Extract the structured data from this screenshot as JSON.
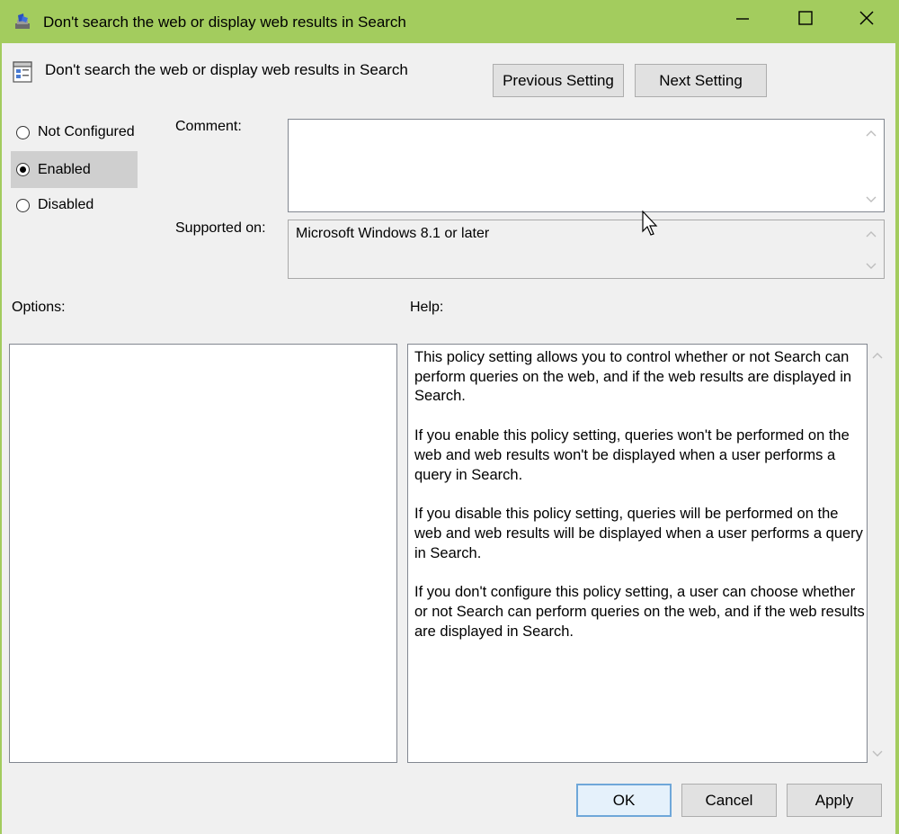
{
  "window": {
    "title": "Don't search the web or display web results in Search"
  },
  "header": {
    "setting_name": "Don't search the web or display web results in Search",
    "previous_label": "Previous Setting",
    "next_label": "Next Setting"
  },
  "state": {
    "options": [
      {
        "label": "Not Configured",
        "checked": false
      },
      {
        "label": "Enabled",
        "checked": true
      },
      {
        "label": "Disabled",
        "checked": false
      }
    ]
  },
  "fields": {
    "comment_label": "Comment:",
    "comment_value": "",
    "supported_label": "Supported on:",
    "supported_value": "Microsoft Windows 8.1 or later"
  },
  "panels": {
    "options_label": "Options:",
    "help_label": "Help:",
    "help_paragraphs": [
      "This policy setting allows you to control whether or not Search can perform queries on the web, and if the web results are displayed in Search.",
      "If you enable this policy setting, queries won't be performed on the web and web results won't be displayed when a user performs a query in Search.",
      "If you disable this policy setting, queries will be performed on the web and web results will be displayed when a user performs a query in Search.",
      "If you don't configure this policy setting, a user can choose whether or not Search can perform queries on the web, and if the web results are displayed in Search."
    ]
  },
  "footer": {
    "ok_label": "OK",
    "cancel_label": "Cancel",
    "apply_label": "Apply"
  },
  "colors": {
    "title_bar": "#a3cc5e",
    "dialog_bg": "#f0f0f0",
    "selected_option": "#cfcfcf",
    "default_button_border": "#6fa7d9"
  }
}
